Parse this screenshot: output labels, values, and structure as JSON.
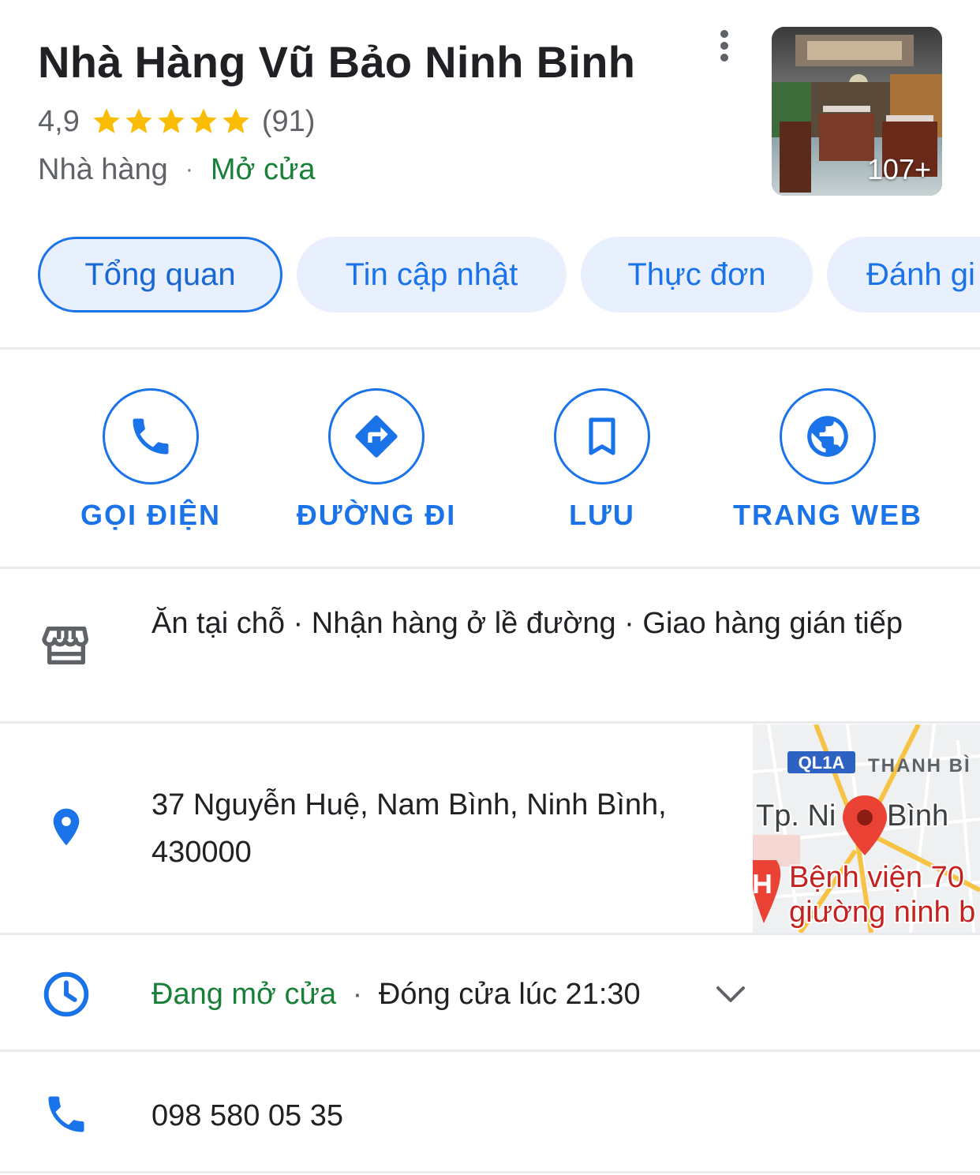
{
  "header": {
    "title": "Nhà Hàng Vũ Bảo Ninh Binh",
    "rating": "4,9",
    "rating_value": 4.9,
    "rating_max": 5,
    "review_count": "(91)",
    "category": "Nhà hàng",
    "separator": "·",
    "open_status": "Mở cửa",
    "photo_count": "107+"
  },
  "tabs": [
    {
      "label": "Tổng quan",
      "active": true
    },
    {
      "label": "Tin cập nhật",
      "active": false
    },
    {
      "label": "Thực đơn",
      "active": false
    },
    {
      "label": "Đánh gi",
      "active": false
    }
  ],
  "actions": [
    {
      "label": "GỌI ĐIỆN",
      "icon": "phone-icon"
    },
    {
      "label": "ĐƯỜNG ĐI",
      "icon": "directions-icon"
    },
    {
      "label": "LƯU",
      "icon": "bookmark-icon"
    },
    {
      "label": "TRANG WEB",
      "icon": "globe-icon"
    }
  ],
  "info": {
    "service_options": "Ăn tại chỗ · Nhận hàng ở lề đường · Giao hàng gián tiếp",
    "address": "37 Nguyễn Huệ, Nam Bình, Ninh Bình, 430000",
    "hours_status": "Đang mở cửa",
    "hours_separator": "·",
    "hours_close": "Đóng cửa lúc 21:30",
    "phone": "098 580 05 35"
  },
  "map": {
    "road_label": "QL1A",
    "area_label": "THANH BÌ",
    "city_label_left": "Tp. Ni",
    "city_label_right": "Bình",
    "poi_line1": "Bệnh viện 70",
    "poi_line2": "giường ninh b"
  },
  "colors": {
    "accent": "#1a73e8",
    "open_green": "#188038",
    "star": "#fbbc04",
    "chip_bg": "#e8f0fe",
    "divider": "#e8eaed",
    "map_pin": "#ea4335"
  }
}
